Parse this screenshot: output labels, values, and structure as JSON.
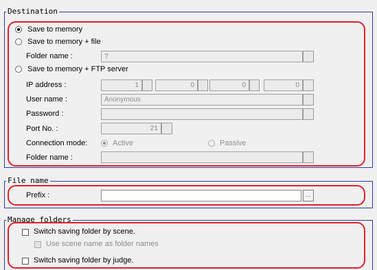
{
  "destination": {
    "title": "Destination",
    "options": {
      "save_to_memory": "Save to memory",
      "save_to_memory_file": "Save to memory + file",
      "save_to_memory_ftp": "Save to memory + FTP server"
    },
    "file_folder_label": "Folder name :",
    "file_folder_value": "?",
    "ip_label": "IP address :",
    "ip_octets": [
      "1",
      "0",
      "0",
      "0"
    ],
    "user_label": "User name :",
    "user_value": "Anonymous",
    "password_label": "Password :",
    "password_value": "",
    "port_label": "Port No. :",
    "port_value": "21",
    "connection_label": "Connection mode:",
    "mode_active": "Active",
    "mode_passive": "Passive",
    "ftp_folder_label": "Folder name :",
    "ftp_folder_value": ""
  },
  "file_name": {
    "title": "File name",
    "prefix_label": "Prefix :",
    "prefix_value": "",
    "browse_label": "..."
  },
  "manage_folders": {
    "title": "Manage folders",
    "switch_by_scene": "Switch saving folder by scene.",
    "use_scene_name": "Use scene name as folder names",
    "switch_by_judge": "Switch saving folder by judge."
  },
  "colors": {
    "frame": "#2c3e9c",
    "highlight": "#e0202a",
    "background": "#f0f0f0"
  }
}
